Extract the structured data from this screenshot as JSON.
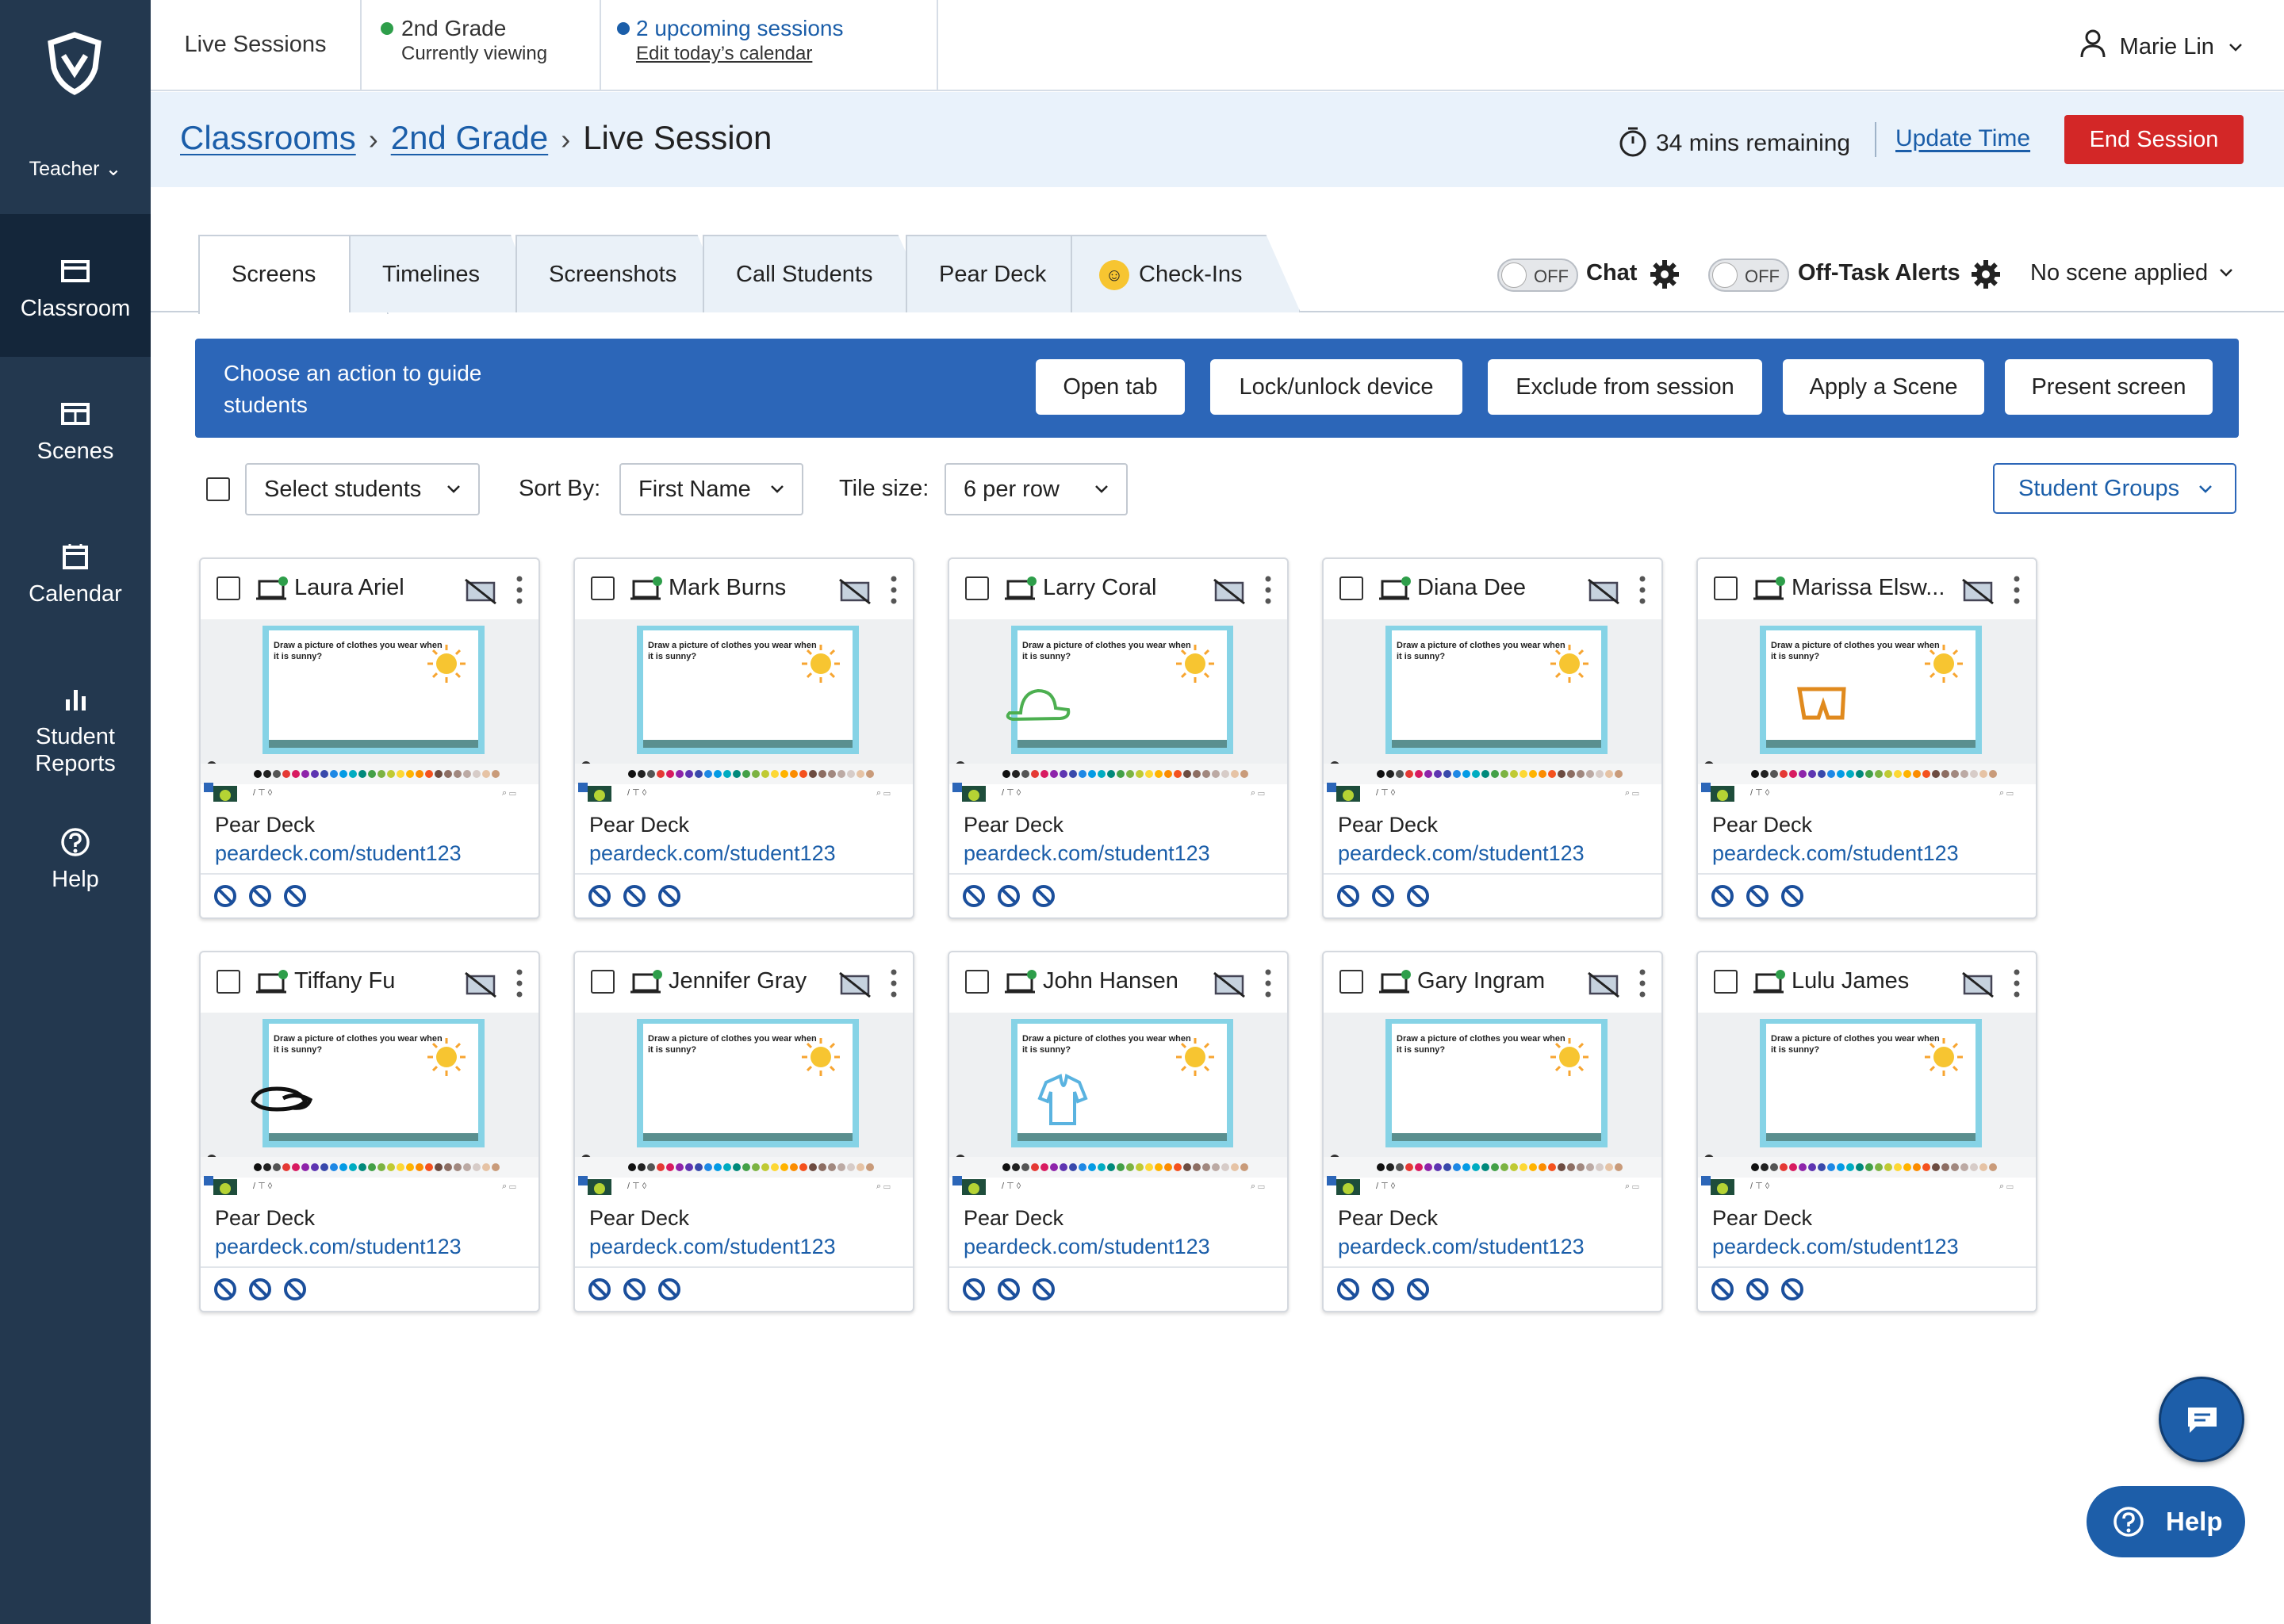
{
  "sidebar": {
    "role": "Teacher",
    "items": [
      {
        "label": "Classroom",
        "icon": "classroom-icon"
      },
      {
        "label": "Scenes",
        "icon": "scenes-icon"
      },
      {
        "label": "Calendar",
        "icon": "calendar-icon"
      },
      {
        "label": "Student Reports",
        "icon": "bar-chart-icon"
      },
      {
        "label": "Help",
        "icon": "help-circle-icon"
      }
    ]
  },
  "topbar": {
    "live_sessions": "Live Sessions",
    "grade_title": "2nd Grade",
    "grade_subtitle": "Currently viewing",
    "upcoming_title": "2 upcoming sessions",
    "upcoming_link": "Edit today’s calendar",
    "user_name": "Marie Lin"
  },
  "breadcrumb": {
    "root": "Classrooms",
    "grade": "2nd Grade",
    "current": "Live Session"
  },
  "session": {
    "remaining": "34 mins remaining",
    "update_time": "Update Time",
    "end_session": "End Session"
  },
  "tabs": [
    "Screens",
    "Timelines",
    "Screenshots",
    "Call Students",
    "Pear Deck",
    "Check-Ins"
  ],
  "toggles": {
    "chat_state": "OFF",
    "chat_label": "Chat",
    "offtask_state": "OFF",
    "offtask_label": "Off-Task Alerts",
    "scene_select": "No scene applied"
  },
  "action_bar": {
    "text": "Choose an action to guide students",
    "buttons": [
      "Open tab",
      "Lock/unlock device",
      "Exclude from session",
      "Apply a Scene",
      "Present screen"
    ]
  },
  "filters": {
    "select_students": "Select students",
    "sort_by_label": "Sort By:",
    "sort_by_value": "First Name",
    "tile_size_label": "Tile size:",
    "tile_size_value": "6 per row",
    "student_groups": "Student Groups"
  },
  "slide": {
    "prompt": "Draw a picture of clothes you wear when it is sunny?"
  },
  "students": [
    {
      "name": "Laura Ariel",
      "app": "Pear Deck",
      "url": "peardeck.com/student123",
      "drawing": "none"
    },
    {
      "name": "Mark Burns",
      "app": "Pear Deck",
      "url": "peardeck.com/student123",
      "drawing": "none"
    },
    {
      "name": "Larry Coral",
      "app": "Pear Deck",
      "url": "peardeck.com/student123",
      "drawing": "hat"
    },
    {
      "name": "Diana Dee",
      "app": "Pear Deck",
      "url": "peardeck.com/student123",
      "drawing": "none"
    },
    {
      "name": "Marissa Elsw...",
      "app": "Pear Deck",
      "url": "peardeck.com/student123",
      "drawing": "shorts"
    },
    {
      "name": "Tiffany Fu",
      "app": "Pear Deck",
      "url": "peardeck.com/student123",
      "drawing": "sandals"
    },
    {
      "name": "Jennifer Gray",
      "app": "Pear Deck",
      "url": "peardeck.com/student123",
      "drawing": "none"
    },
    {
      "name": "John Hansen",
      "app": "Pear Deck",
      "url": "peardeck.com/student123",
      "drawing": "shirt"
    },
    {
      "name": "Gary Ingram",
      "app": "Pear Deck",
      "url": "peardeck.com/student123",
      "drawing": "none"
    },
    {
      "name": "Lulu James",
      "app": "Pear Deck",
      "url": "peardeck.com/student123",
      "drawing": "none"
    }
  ],
  "help_button": "Help",
  "colors": {
    "sidebar": "#23384f",
    "sidebar_active": "#14263a",
    "accent": "#2c66b8",
    "link": "#1b5ea9",
    "danger": "#d32727",
    "online": "#2e9e4a"
  }
}
